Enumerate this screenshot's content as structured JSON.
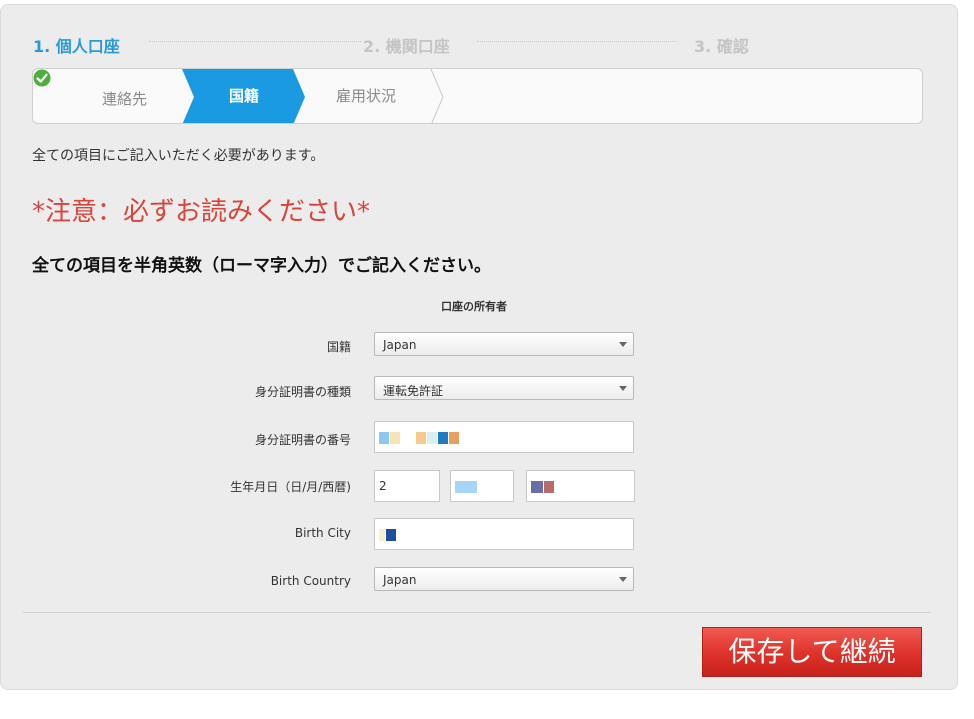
{
  "steps": [
    {
      "label": "1. 個人口座",
      "active": true
    },
    {
      "label": "2. 機関口座",
      "active": false
    },
    {
      "label": "3. 確認",
      "active": false
    }
  ],
  "subtabs": [
    {
      "label": "連絡先",
      "state": "done",
      "icon": "check-circle-icon"
    },
    {
      "label": "国籍",
      "state": "active"
    },
    {
      "label": "雇用状況",
      "state": "pending"
    }
  ],
  "colors": {
    "accent": "#2a9ad6",
    "active_tab": "#1a9ae0",
    "warning": "#d9443b",
    "save_button": "#e0342c",
    "done_check": "#4caf3a"
  },
  "notice": "全ての項目にご記入いただく必要があります。",
  "warning": "*注意：必ずお読みください*",
  "instruction": "全ての項目を半角英数（ローマ字入力）でご記入ください。",
  "owner_header": "口座の所有者",
  "fields": {
    "nationality": {
      "label": "国籍",
      "value": "Japan"
    },
    "id_type": {
      "label": "身分証明書の種類",
      "value": "運転免許証"
    },
    "id_number": {
      "label": "身分証明書の番号",
      "value": ""
    },
    "birthdate": {
      "label": "生年月日（日/月/西暦)",
      "day": "2",
      "month": "",
      "year": ""
    },
    "birth_city": {
      "label": "Birth City",
      "value": ""
    },
    "birth_country": {
      "label": "Birth Country",
      "value": "Japan"
    }
  },
  "save_button": "保存して継続"
}
